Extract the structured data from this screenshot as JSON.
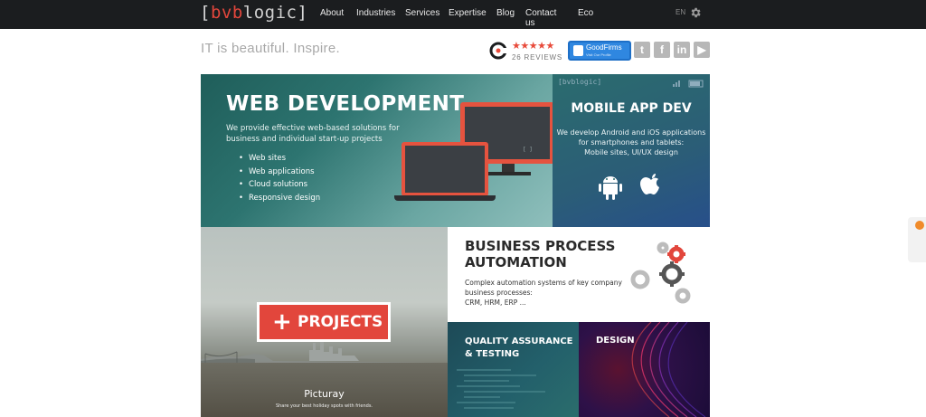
{
  "header": {
    "logo_open": "[",
    "logo_bv": "bv",
    "logo_b": "b",
    "logo_logic": "logic",
    "logo_close": "]",
    "nav": [
      "About",
      "Industries",
      "Services",
      "Expertise",
      "Blog",
      "Contact us",
      "Eco"
    ],
    "lang": "EN"
  },
  "subheader": {
    "slogan": "IT is beautiful. Inspire.",
    "stars": "★★★★★",
    "reviews": "26 REVIEWS",
    "goodfirms": "GoodFirms",
    "goodfirms_sub": "Visit Our Profile",
    "social": [
      "twitter-icon",
      "facebook-icon",
      "linkedin-icon",
      "youtube-icon"
    ]
  },
  "tiles": {
    "web": {
      "title": "WEB DEVELOPMENT",
      "desc": "We provide effective web-based solutions for business and individual start-up projects",
      "items": [
        "Web sites",
        "Web applications",
        "Cloud solutions",
        "Responsive design"
      ],
      "screen_mark": "[ ]"
    },
    "mobile": {
      "brand": "[bvblogic]",
      "title": "MOBILE APP DEV",
      "desc_line1": "We develop Android and iOS applications",
      "desc_line2": "for smartphones and tablets:",
      "desc_line3": "Mobile sites, UI/UX design"
    },
    "projects": {
      "plus": "+",
      "label": "PROJECTS",
      "caption_title": "Picturay",
      "caption_sub": "Share your best holiday spots with friends."
    },
    "bpa": {
      "title_line1": "BUSINESS PROCESS",
      "title_line2": "AUTOMATION",
      "desc_line1": "Complex automation systems of key company",
      "desc_line2": "business processes:",
      "desc_line3": "CRM, HRM, ERP ..."
    },
    "qa": {
      "title_line1": "QUALITY ASSURANCE",
      "title_line2": "& TESTING"
    },
    "design": {
      "title": "DESIGN"
    }
  },
  "colors": {
    "accent": "#e2463c",
    "topbar": "#1b1d1f",
    "goodfirms": "#2f87e0",
    "web_tile": "#2d7470",
    "mobile_tile": "#2b5d77"
  }
}
